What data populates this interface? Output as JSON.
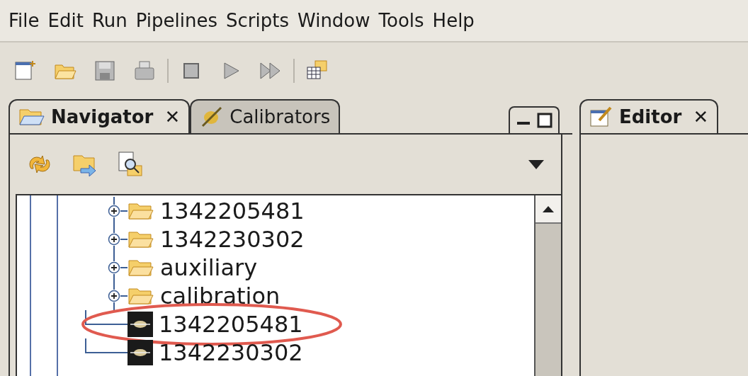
{
  "menu": [
    "File",
    "Edit",
    "Run",
    "Pipelines",
    "Scripts",
    "Window",
    "Tools",
    "Help"
  ],
  "toolbar": [
    {
      "kind": "new",
      "disabled": false
    },
    {
      "kind": "open",
      "disabled": false
    },
    {
      "kind": "save",
      "disabled": true
    },
    {
      "kind": "print",
      "disabled": true
    },
    {
      "kind": "separator"
    },
    {
      "kind": "stop",
      "disabled": true
    },
    {
      "kind": "run",
      "disabled": true
    },
    {
      "kind": "run-all",
      "disabled": true
    },
    {
      "kind": "separator"
    },
    {
      "kind": "table",
      "disabled": false
    }
  ],
  "navigator": {
    "tabs": [
      {
        "label": "Navigator",
        "selected": true,
        "close": "✕"
      },
      {
        "label": "Calibrators",
        "selected": false
      }
    ],
    "items": [
      {
        "kind": "folder",
        "label": "1342205481",
        "expanded": false,
        "highlighted": false
      },
      {
        "kind": "folder",
        "label": "1342230302",
        "expanded": false,
        "highlighted": false
      },
      {
        "kind": "folder",
        "label": "auxiliary",
        "expanded": false,
        "highlighted": false
      },
      {
        "kind": "folder",
        "label": "calibration",
        "expanded": false,
        "highlighted": false
      },
      {
        "kind": "file",
        "label": "1342205481",
        "highlighted": true
      },
      {
        "kind": "file",
        "label": "1342230302",
        "highlighted": false
      }
    ]
  },
  "editor": {
    "tabs": [
      {
        "label": "Editor",
        "selected": true,
        "close": "✕"
      }
    ]
  }
}
